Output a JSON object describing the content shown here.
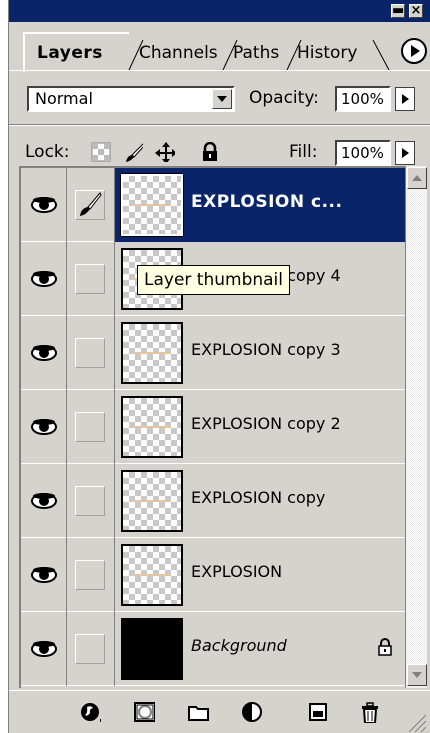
{
  "window": {
    "minimize_glyph": "▬",
    "close_glyph": "×"
  },
  "tabs": [
    {
      "label": "Layers",
      "active": true
    },
    {
      "label": "Channels",
      "active": false
    },
    {
      "label": "Paths",
      "active": false
    },
    {
      "label": "History",
      "active": false
    }
  ],
  "blend": {
    "mode": "Normal"
  },
  "opacity": {
    "label": "Opacity:",
    "value": "100%"
  },
  "lock": {
    "label": "Lock:",
    "icons": [
      "transparency-lock-icon",
      "brush-lock-icon",
      "move-lock-icon",
      "padlock-icon"
    ]
  },
  "fill": {
    "label": "Fill:",
    "value": "100%"
  },
  "layers": [
    {
      "name": "EXPLOSION c...",
      "selected": true,
      "visible": true,
      "brush": true
    },
    {
      "name": "EXPLOSION copy 4",
      "selected": false,
      "visible": true,
      "brush": false
    },
    {
      "name": "EXPLOSION copy 3",
      "selected": false,
      "visible": true,
      "brush": false
    },
    {
      "name": "EXPLOSION copy 2",
      "selected": false,
      "visible": true,
      "brush": false
    },
    {
      "name": "EXPLOSION copy",
      "selected": false,
      "visible": true,
      "brush": false
    },
    {
      "name": "EXPLOSION",
      "selected": false,
      "visible": true,
      "brush": false
    },
    {
      "name": "Background",
      "selected": false,
      "visible": true,
      "brush": false,
      "locked": true,
      "black_fill": true
    }
  ],
  "tooltip": {
    "text": "Layer thumbnail"
  },
  "bottom_icons": [
    "layer-style-icon",
    "mask-icon",
    "new-set-icon",
    "adjustment-layer-icon",
    "new-layer-icon",
    "trash-icon"
  ],
  "colors": {
    "title_bar": "#0a246a",
    "panel": "#d6d3ce",
    "selection": "#0a246a",
    "tooltip": "#ffffe1"
  }
}
